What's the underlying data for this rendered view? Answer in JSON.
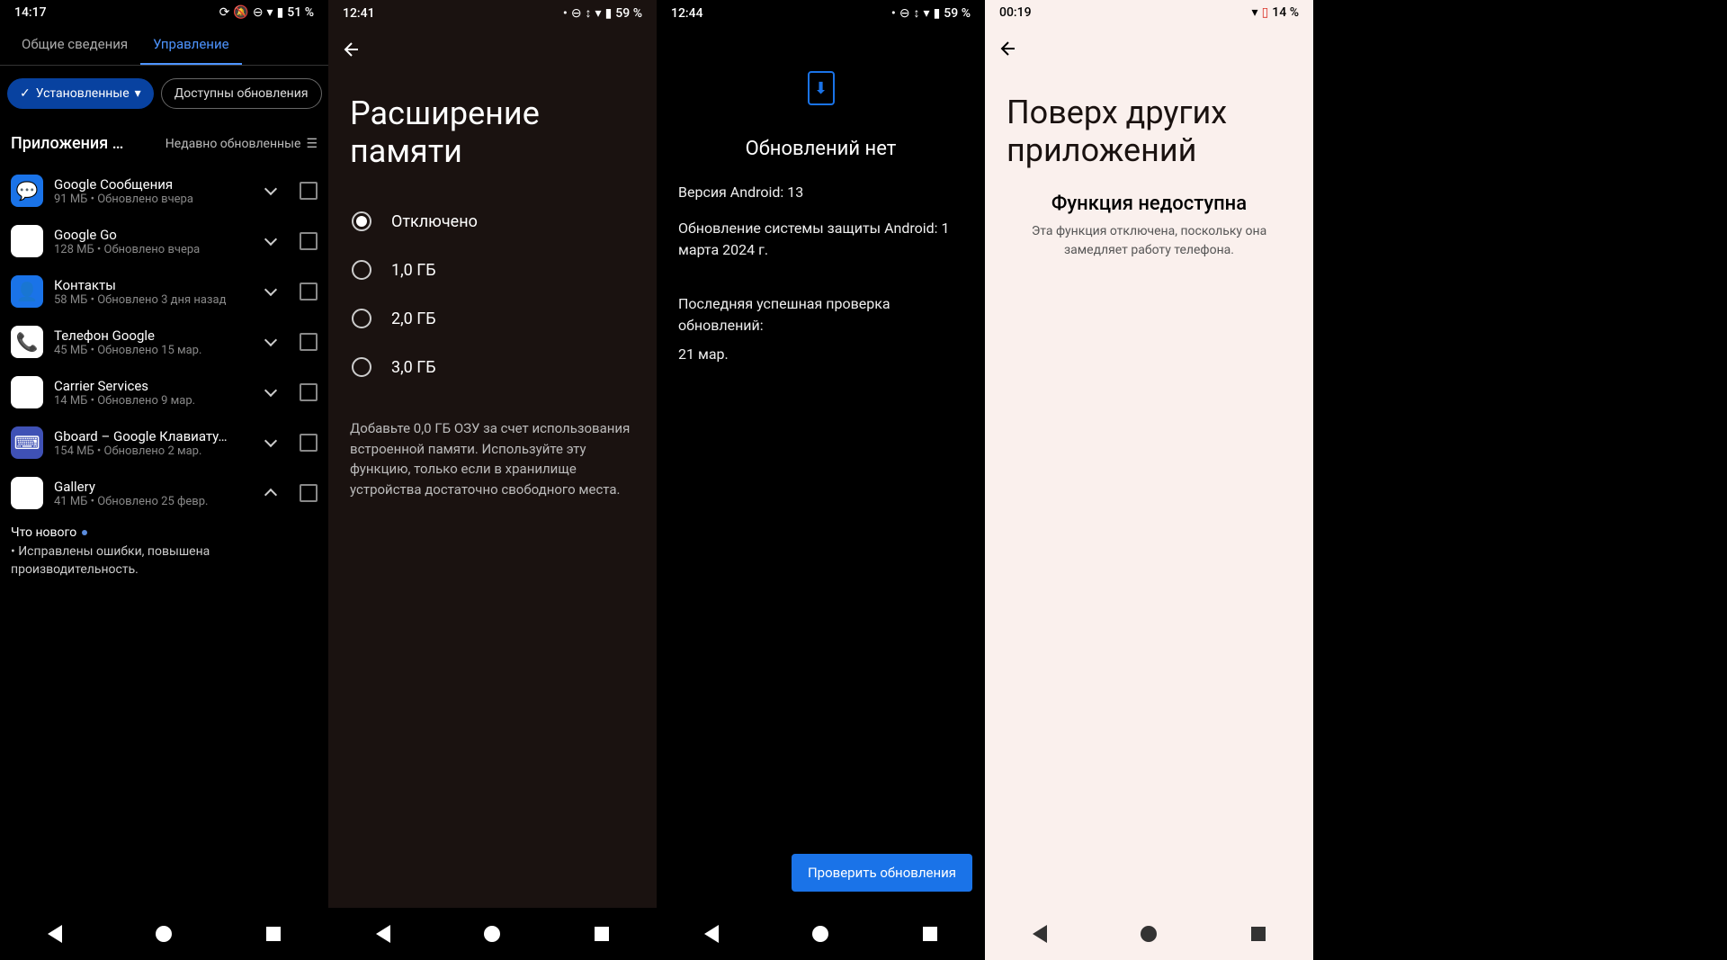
{
  "s1": {
    "time": "14:17",
    "battery": "51 %",
    "tabs": {
      "general": "Общие сведения",
      "manage": "Управление"
    },
    "filters": {
      "installed": "Установленные",
      "updates": "Доступны обновления"
    },
    "section_title": "Приложения …",
    "sort": "Недавно обновленные",
    "apps": [
      {
        "name": "Google Сообщения",
        "meta": "91 МБ  •  Обновлено вчера"
      },
      {
        "name": "Google Go",
        "meta": "128 МБ  •  Обновлено вчера"
      },
      {
        "name": "Контакты",
        "meta": "58 МБ  •  Обновлено 3 дня назад"
      },
      {
        "name": "Телефон Google",
        "meta": "45 МБ  •  Обновлено 15 мар."
      },
      {
        "name": "Carrier Services",
        "meta": "14 МБ  •  Обновлено 9 мар."
      },
      {
        "name": "Gboard – Google Клавиату…",
        "meta": "154 МБ  •  Обновлено 2 мар."
      },
      {
        "name": "Gallery",
        "meta": "41 МБ  •  Обновлено 25 февр."
      }
    ],
    "whats_new_label": "Что нового",
    "whats_new_text": "• Исправлены ошибки, повышена производительность."
  },
  "s2": {
    "time": "12:41",
    "battery": "59 %",
    "title": "Расширение памяти",
    "options": [
      {
        "label": "Отключено",
        "checked": true
      },
      {
        "label": "1,0 ГБ",
        "checked": false
      },
      {
        "label": "2,0 ГБ",
        "checked": false
      },
      {
        "label": "3,0 ГБ",
        "checked": false
      }
    ],
    "desc": "Добавьте 0,0 ГБ ОЗУ за счет использования встроенной памяти. Используйте эту функцию, только если в хранилище устройства достаточно свободного места."
  },
  "s3": {
    "time": "12:44",
    "battery": "59 %",
    "title": "Обновлений нет",
    "version_line": "Версия Android: 13",
    "security_line": "Обновление системы защиты Android: 1 марта 2024 г.",
    "last_check_label": "Последняя успешная проверка обновлений:",
    "last_check_date": "21 мар.",
    "check_btn": "Проверить обновления"
  },
  "s4": {
    "time": "00:19",
    "battery": "14 %",
    "title": "Поверх других приложений",
    "unavail_title": "Функция недоступна",
    "unavail_desc": "Эта функция отключена, поскольку она замедляет работу телефона."
  }
}
